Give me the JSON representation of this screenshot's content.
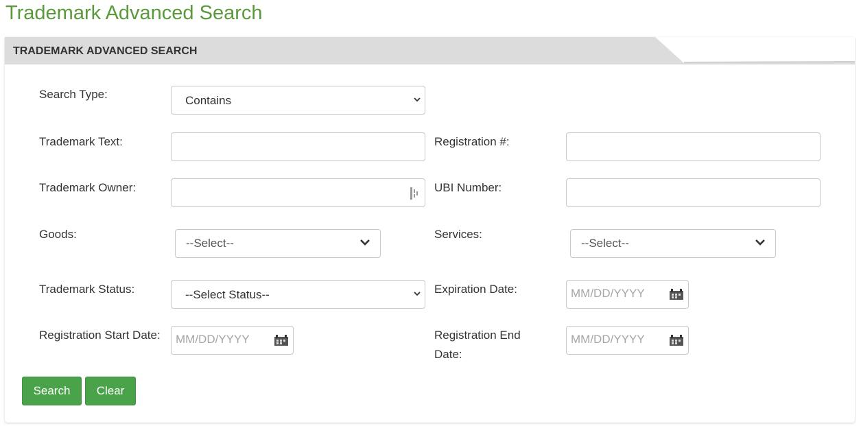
{
  "page_title": "Trademark Advanced Search",
  "panel": {
    "header": "TRADEMARK ADVANCED SEARCH"
  },
  "form": {
    "search_type": {
      "label": "Search Type:",
      "value": "Contains"
    },
    "trademark_text": {
      "label": "Trademark Text:",
      "value": ""
    },
    "registration_number": {
      "label": "Registration #:",
      "value": ""
    },
    "trademark_owner": {
      "label": "Trademark Owner:",
      "value": ""
    },
    "ubi_number": {
      "label": "UBI Number:",
      "value": ""
    },
    "goods": {
      "label": "Goods:",
      "value": "--Select--"
    },
    "services": {
      "label": "Services:",
      "value": "--Select--"
    },
    "trademark_status": {
      "label": "Trademark Status:",
      "value": "--Select Status--"
    },
    "expiration_date": {
      "label": "Expiration Date:",
      "placeholder": "MM/DD/YYYY"
    },
    "registration_start_date": {
      "label": "Registration Start Date:",
      "placeholder": "MM/DD/YYYY"
    },
    "registration_end_date": {
      "label_line1": "Registration End",
      "label_line2": "Date:",
      "placeholder": "MM/DD/YYYY"
    }
  },
  "buttons": {
    "search": "Search",
    "clear": "Clear"
  },
  "colors": {
    "title_green": "#5a9a3a",
    "button_green": "#4aa24a",
    "header_bg": "#dcdcdc"
  }
}
